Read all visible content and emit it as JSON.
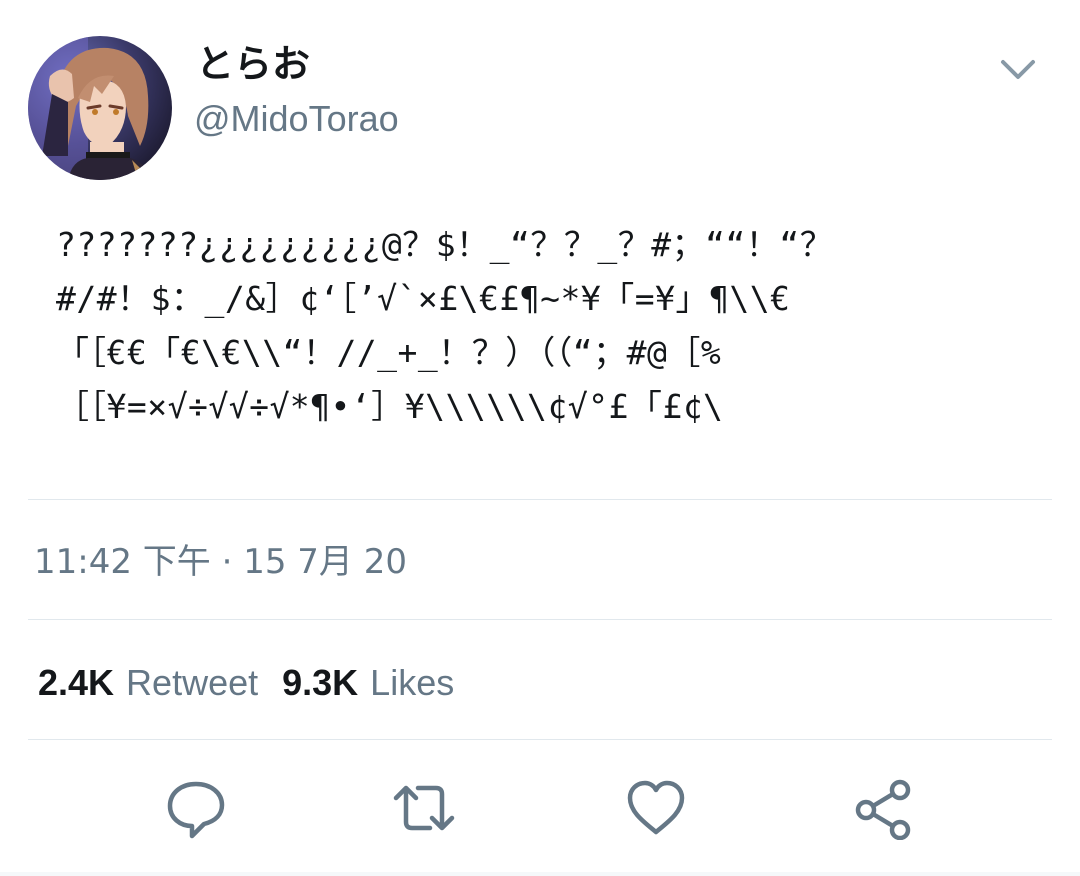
{
  "user": {
    "display_name": "とらお",
    "username": "@MidoTorao"
  },
  "tweet": {
    "lines": [
      "???????¿¿¿¿¿¿¿¿¿@？$！_“？？_？#；““！“？",
      "#/#！$：_/&］¢‘［’√`×£\\€£¶~*¥「=¥」¶\\\\€",
      "「［€€「€\\€\\\\“！//_+_！？）（（“；#@［%",
      "［［¥=×√÷√√÷√*¶•‘］¥\\\\\\\\\\\\¢√°£「£¢\\"
    ],
    "timestamp": "11:42 下午 · 15 7月 20"
  },
  "stats": {
    "retweets_count": "2.4K",
    "retweets_label": "Retweet",
    "likes_count": "9.3K",
    "likes_label": "Likes"
  },
  "actions": {
    "reply_icon": "reply-icon",
    "retweet_icon": "retweet-icon",
    "like_icon": "heart-icon",
    "share_icon": "share-icon"
  },
  "colors": {
    "text": "#14171a",
    "secondary": "#657786",
    "divider": "#e1e8ed",
    "icon": "#657786"
  }
}
